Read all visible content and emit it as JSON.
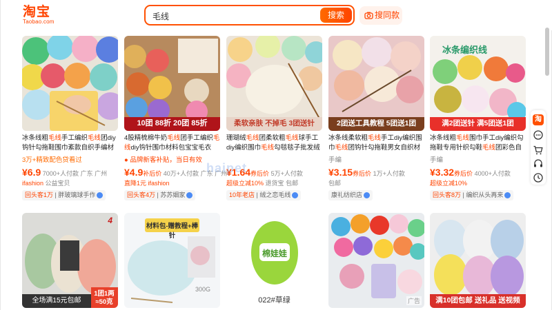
{
  "header": {
    "logo_main": "淘宝",
    "logo_sub": "Taobao.com",
    "search_value": "毛线",
    "search_button": "搜索",
    "image_search_label": "搜同款"
  },
  "watermark": "haipet",
  "products": [
    {
      "title_parts": [
        "冰条线粗",
        "毛线",
        "手工编织",
        "毛线",
        "团diy钩针勾拖鞋围巾紊款自织手编材料"
      ],
      "tag": "3万+精致配色贷看过",
      "price": "¥6.9",
      "sales": "7000+人付款",
      "location": "广东 广州",
      "sub1": "ifashion",
      "sub2": "公益宝贝",
      "shop_prefix": "回头客1万",
      "shop": "胖玻璃球手作"
    },
    {
      "title_parts": [
        "4股精梳棉牛奶",
        "毛线",
        "团手工编织",
        "毛线",
        "diy钩针围巾材料包宝宝毛衣"
      ],
      "tag": "品牌新客补贴，当日有效",
      "banner": "10团 88折    20团 85折",
      "price": "¥4.9",
      "price_suffix": "补后价",
      "sales": "40万+人付款",
      "location": "广东 广州",
      "sub1": "直降1元",
      "sub2": "ifashion",
      "shop_prefix": "回头客4万",
      "shop": "苏苏姻家"
    },
    {
      "title_parts": [
        "珊瑚绒",
        "毛线",
        "团柔软粗",
        "毛线",
        "球手工diy编织围巾",
        "毛线",
        "勾毯毯子批发绒绒线"
      ],
      "tag": "",
      "banner": "柔软亲肤 不掉毛  3团送针",
      "price": "¥1.64",
      "price_suffix": "券后价",
      "sales": "5万+人付款",
      "location": "",
      "sub1": "超级立减10%",
      "sub2": "退货宝",
      "sub3": "包邮",
      "shop_prefix": "10年老店",
      "shop": "绒之恋毛线"
    },
    {
      "title_parts": [
        "冰条线柔软粗",
        "毛线",
        "手工diy编织围巾",
        "毛线",
        "团钩针勾拖鞋男女自织材料"
      ],
      "tag": "手编",
      "banner": "2团送工具教程  5团送1团",
      "price": "¥3.15",
      "price_suffix": "券后价",
      "sales": "1万+人付款",
      "location": "",
      "sub1": "",
      "sub2": "包邮",
      "shop_prefix": "",
      "shop": "康礼纺织店"
    },
    {
      "title_parts": [
        "冰条线粗",
        "毛线",
        "围巾手工diy编织勾拖鞋专用针织勾鞋",
        "毛线",
        "团彩色自织"
      ],
      "tag": "手编",
      "banner": "满2团送针   满5团送1团",
      "img_title": "冰条编织线",
      "price": "¥3.32",
      "price_suffix": "券后价",
      "sales": "4000+人付款",
      "location": "",
      "sub1": "超级立减10%",
      "sub2": "",
      "shop_prefix": "回头客8万",
      "shop": "编织从头再来"
    }
  ],
  "row2": [
    {
      "badge": "1团1两 ≈50克",
      "banner": "全场满15元包邮",
      "corner": "4"
    },
    {
      "banner": "材料包-赠教程+棒针",
      "label": "300G"
    },
    {
      "label": "022#草绿",
      "brand": "棉娃娃"
    },
    {
      "corner": "广告"
    },
    {
      "banner": "满10团包邮   送礼品 送视频"
    }
  ],
  "sidebar": [
    "淘",
    "feedback-icon",
    "cart-icon",
    "service-icon",
    "history-icon"
  ],
  "colors": {
    "accent": "#ff4400",
    "search_border": "#ff5000"
  }
}
